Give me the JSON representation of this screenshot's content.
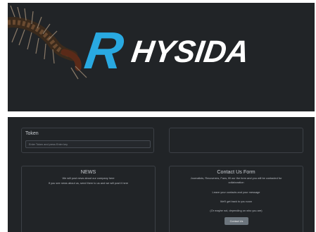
{
  "banner": {
    "logo_text": "RHYSIDA",
    "logo_colors": {
      "r": "#29a9e1",
      "rest": "#ffffff"
    }
  },
  "token": {
    "title": "Token",
    "placeholder": "Enter Token and press Enter key"
  },
  "news": {
    "title": "NEWS",
    "lines": [
      "We will post news about our company here",
      "If you see news about us, send them to us and we will post it here"
    ]
  },
  "contact": {
    "title": "Contact Us Form",
    "lines": [
      "Journalists, Recoverers, Fans, fill our the form and you will be contacted for",
      "collaboration",
      "Leave your contacts and your message",
      "We'll get back to you soon",
      "(Or maybe not, depending on who you are)"
    ],
    "button_label": "Contact Us"
  }
}
